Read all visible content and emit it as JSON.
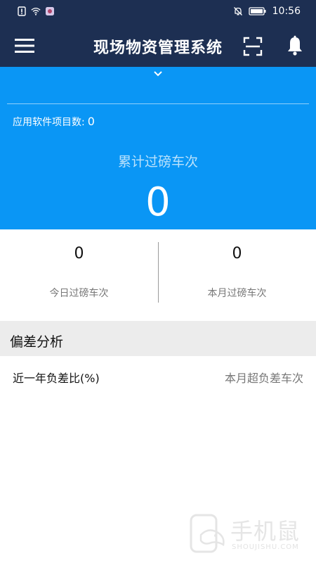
{
  "status_bar": {
    "time": "10:56",
    "icons": [
      "notification-icon",
      "wifi-icon",
      "app-icon",
      "mute-icon",
      "battery-icon"
    ]
  },
  "app_bar": {
    "title": "现场物资管理系统",
    "icons": [
      "menu-icon",
      "scan-icon",
      "bell-icon"
    ]
  },
  "summary": {
    "project_label": "应用软件项目数:",
    "project_value": "0",
    "total_label": "累计过磅车次",
    "total_value": "0"
  },
  "stats": [
    {
      "value": "0",
      "label": "今日过磅车次"
    },
    {
      "value": "0",
      "label": "本月过磅车次"
    }
  ],
  "deviation": {
    "title": "偏差分析",
    "left_label": "近一年负差比(%)",
    "right_label": "本月超负差车次"
  },
  "watermark": {
    "text": "手机鼠",
    "subtext": "SHOUJISHU.COM"
  },
  "colors": {
    "header_bg": "#1d2f52",
    "hero_bg": "#0a96f5",
    "section_bg": "#ececec"
  }
}
